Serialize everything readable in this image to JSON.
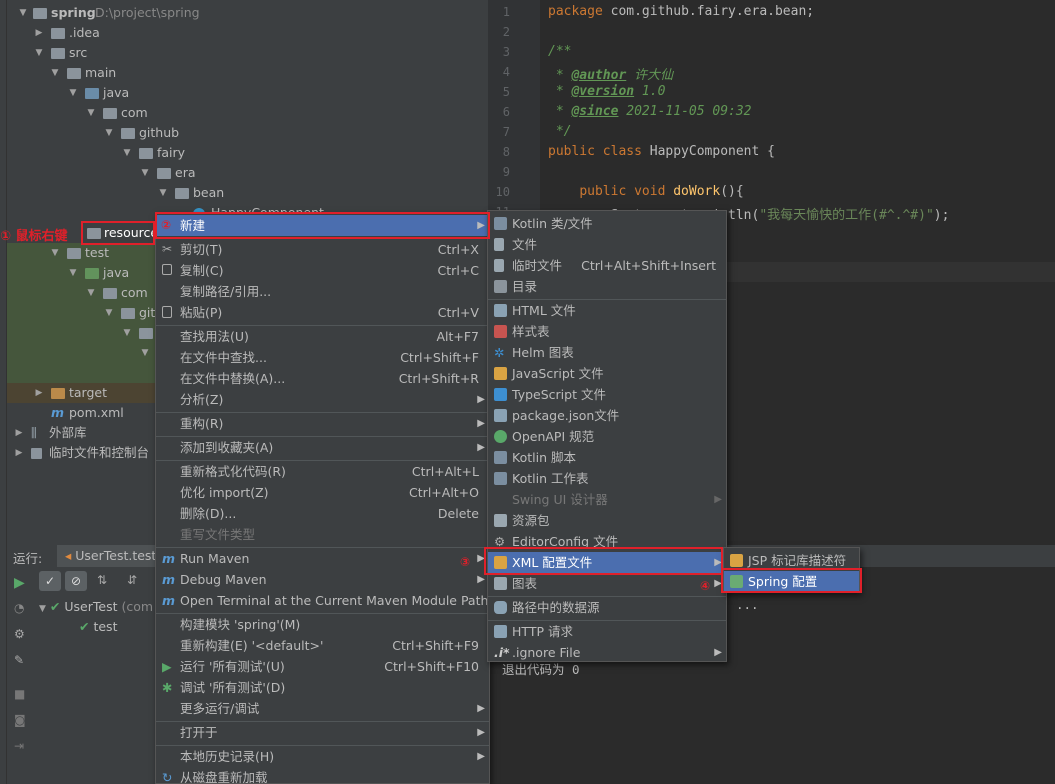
{
  "project": {
    "root_name": "spring",
    "root_path": "D:\\project\\spring",
    "items": [
      {
        "label": ".idea"
      },
      {
        "label": "src"
      },
      {
        "label": "main"
      },
      {
        "label": "java"
      },
      {
        "label": "com"
      },
      {
        "label": "github"
      },
      {
        "label": "fairy"
      },
      {
        "label": "era"
      },
      {
        "label": "bean"
      },
      {
        "label": "HappyComponent"
      },
      {
        "label": "resources"
      },
      {
        "label": "test"
      },
      {
        "label": "java"
      },
      {
        "label": "com"
      },
      {
        "label": "git"
      },
      {
        "label": "target"
      },
      {
        "label": "pom.xml"
      },
      {
        "label": "外部库"
      },
      {
        "label": "临时文件和控制台"
      }
    ]
  },
  "annotations": {
    "step1": "① 鼠标右键",
    "step2": "②",
    "step3": "③",
    "step4": "④"
  },
  "editor": {
    "line_numbers": [
      "1",
      "2",
      "3",
      "4",
      "5",
      "6",
      "7",
      "8",
      "9",
      "10",
      "11"
    ],
    "package_kw": "package",
    "package_name": " com.github.fairy.era.bean;",
    "doc_open": "/**",
    "author_tag": "@author",
    "author_val": " 许大仙",
    "version_tag": "@version",
    "version_val": " 1.0",
    "since_tag": "@since",
    "since_val": " 2021-11-05 09:32",
    "doc_close": " */",
    "class_kw": "public class",
    "class_name": " HappyComponent {",
    "method_kw": "public void",
    "method_name": " doWork",
    "method_rest": "(){",
    "println_pre": "System.out.println(",
    "println_str": "\"我每天愉快的工作(#^.^#)\"",
    "println_post": ");"
  },
  "run": {
    "title": "运行:",
    "tab": "UserTest.test",
    "tree_root": "UserTest",
    "tree_root_suffix": "(com",
    "tree_child": "test",
    "console_dots": "...",
    "console_exit": "退出代码为 0"
  },
  "context_menu": {
    "items": [
      {
        "label": "新建",
        "submenu": true
      },
      {
        "label": "剪切(T)",
        "shortcut": "Ctrl+X"
      },
      {
        "label": "复制(C)",
        "shortcut": "Ctrl+C"
      },
      {
        "label": "复制路径/引用..."
      },
      {
        "label": "粘贴(P)",
        "shortcut": "Ctrl+V"
      },
      {
        "label": "查找用法(U)",
        "shortcut": "Alt+F7"
      },
      {
        "label": "在文件中查找...",
        "shortcut": "Ctrl+Shift+F"
      },
      {
        "label": "在文件中替换(A)...",
        "shortcut": "Ctrl+Shift+R"
      },
      {
        "label": "分析(Z)",
        "submenu": true
      },
      {
        "label": "重构(R)",
        "submenu": true
      },
      {
        "label": "添加到收藏夹(A)",
        "submenu": true
      },
      {
        "label": "重新格式化代码(R)",
        "shortcut": "Ctrl+Alt+L"
      },
      {
        "label": "优化 import(Z)",
        "shortcut": "Ctrl+Alt+O"
      },
      {
        "label": "删除(D)...",
        "shortcut": "Delete"
      },
      {
        "label": "重写文件类型"
      },
      {
        "label": "Run Maven",
        "submenu": true
      },
      {
        "label": "Debug Maven",
        "submenu": true
      },
      {
        "label": "Open Terminal at the Current Maven Module Path"
      },
      {
        "label": "构建模块 'spring'(M)"
      },
      {
        "label": "重新构建(E) '<default>'",
        "shortcut": "Ctrl+Shift+F9"
      },
      {
        "label": "运行 '所有测试'(U)",
        "shortcut": "Ctrl+Shift+F10"
      },
      {
        "label": "调试 '所有测试'(D)"
      },
      {
        "label": "更多运行/调试",
        "submenu": true
      },
      {
        "label": "打开于",
        "submenu": true
      },
      {
        "label": "本地历史记录(H)",
        "submenu": true
      },
      {
        "label": "从磁盘重新加载"
      }
    ]
  },
  "new_menu": {
    "items": [
      {
        "label": "Kotlin 类/文件"
      },
      {
        "label": "文件"
      },
      {
        "label": "临时文件",
        "shortcut": "Ctrl+Alt+Shift+Insert"
      },
      {
        "label": "目录"
      },
      {
        "label": "HTML 文件"
      },
      {
        "label": "样式表"
      },
      {
        "label": "Helm 图表"
      },
      {
        "label": "JavaScript 文件"
      },
      {
        "label": "TypeScript 文件"
      },
      {
        "label": "package.json文件"
      },
      {
        "label": "OpenAPI 规范"
      },
      {
        "label": "Kotlin 脚本"
      },
      {
        "label": "Kotlin 工作表"
      },
      {
        "label": "Swing UI 设计器"
      },
      {
        "label": "资源包"
      },
      {
        "label": "EditorConfig 文件"
      },
      {
        "label": "XML 配置文件"
      },
      {
        "label": "图表"
      },
      {
        "label": "路径中的数据源"
      },
      {
        "label": "HTTP 请求"
      },
      {
        "label": ".ignore File"
      }
    ]
  },
  "xml_menu": {
    "items": [
      {
        "label": "JSP 标记库描述符"
      },
      {
        "label": "Spring 配置"
      }
    ]
  },
  "colors": {
    "selection": "#4b6eaf",
    "annotation_red": "#e0202a",
    "panel": "#3c3f41",
    "editor_bg": "#2b2b2b"
  }
}
